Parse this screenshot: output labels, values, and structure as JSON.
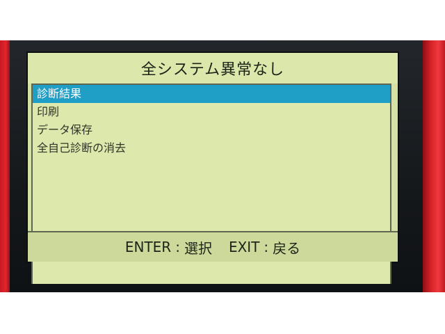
{
  "title": "全システム異常なし",
  "menu": {
    "items": [
      {
        "label": "診断結果",
        "selected": true
      },
      {
        "label": "印刷",
        "selected": false
      },
      {
        "label": "データ保存",
        "selected": false
      },
      {
        "label": "全自己診断の消去",
        "selected": false
      }
    ]
  },
  "footer": {
    "enter_key": "ENTER",
    "enter_action": "選択",
    "exit_key": "EXIT",
    "exit_action": "戻る",
    "separator": ":"
  },
  "colors": {
    "screen_background": "#d4e0a4",
    "selection_highlight": "#1f9fc6",
    "device_case": "#e0262c"
  }
}
